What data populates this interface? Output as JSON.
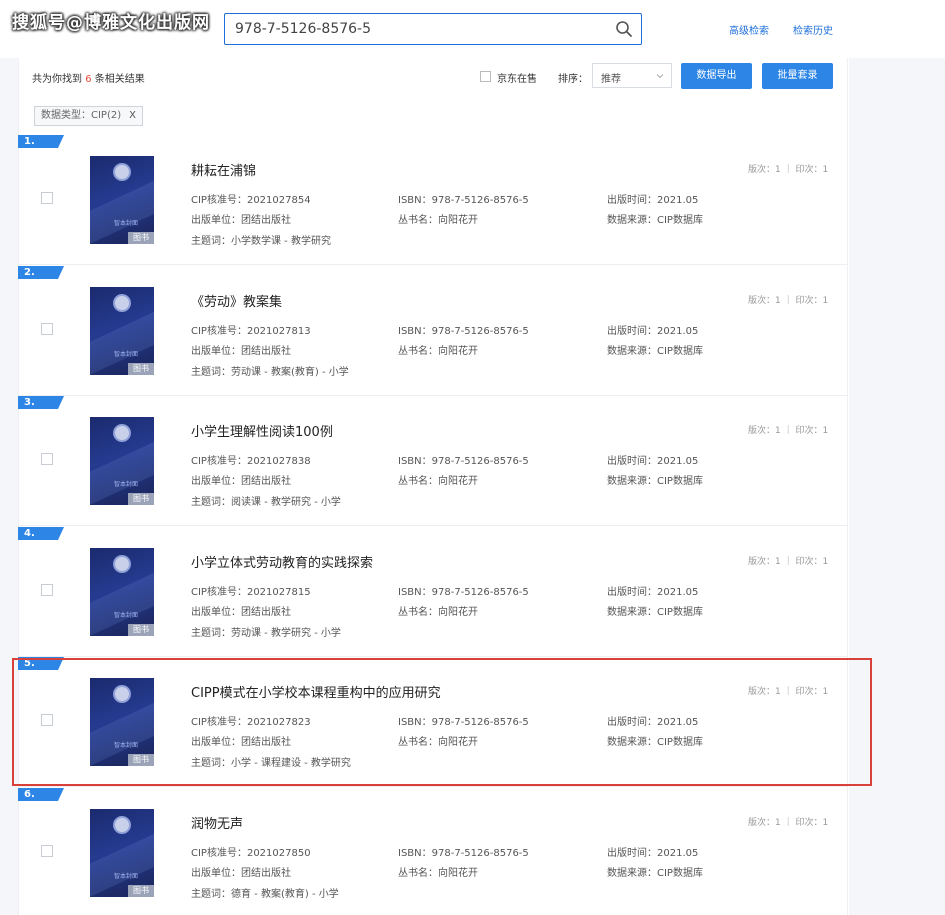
{
  "watermark": "搜狐号@博雅文化出版网",
  "search": {
    "value": "978-7-5126-8576-5",
    "advanced_label": "高级检索",
    "history_label": "检索历史"
  },
  "toolbar": {
    "result_prefix": "共为你找到",
    "result_count": "6",
    "result_suffix": "条相关结果",
    "jd_label": "京东在售",
    "sort_label": "排序：",
    "sort_value": "推荐",
    "export_label": "数据导出",
    "batch_label": "批量套录"
  },
  "filter": {
    "label": "数据类型：CIP(2)",
    "close": "X"
  },
  "cover_tag": "图书",
  "cover_text": "智本封面",
  "results": [
    {
      "num": "1.",
      "title": "耕耘在浦锦",
      "cip": "CIP核准号：2021027854",
      "isbn": "ISBN：978-7-5126-8576-5",
      "pubdate": "出版时间：2021.05",
      "publisher": "出版单位：团结出版社",
      "series": "丛书名：向阳花开",
      "source": "数据来源：CIP数据库",
      "subject": "主题词：小学数学课 - 教学研究",
      "edition": "版次：1 ｜ 印次：1"
    },
    {
      "num": "2.",
      "title": "《劳动》教案集",
      "cip": "CIP核准号：2021027813",
      "isbn": "ISBN：978-7-5126-8576-5",
      "pubdate": "出版时间：2021.05",
      "publisher": "出版单位：团结出版社",
      "series": "丛书名：向阳花开",
      "source": "数据来源：CIP数据库",
      "subject": "主题词：劳动课 - 教案(教育) - 小学",
      "edition": "版次：1 ｜ 印次：1"
    },
    {
      "num": "3.",
      "title": "小学生理解性阅读100例",
      "cip": "CIP核准号：2021027838",
      "isbn": "ISBN：978-7-5126-8576-5",
      "pubdate": "出版时间：2021.05",
      "publisher": "出版单位：团结出版社",
      "series": "丛书名：向阳花开",
      "source": "数据来源：CIP数据库",
      "subject": "主题词：阅读课 - 教学研究 - 小学",
      "edition": "版次：1 ｜ 印次：1"
    },
    {
      "num": "4.",
      "title": "小学立体式劳动教育的实践探索",
      "cip": "CIP核准号：2021027815",
      "isbn": "ISBN：978-7-5126-8576-5",
      "pubdate": "出版时间：2021.05",
      "publisher": "出版单位：团结出版社",
      "series": "丛书名：向阳花开",
      "source": "数据来源：CIP数据库",
      "subject": "主题词：劳动课 - 教学研究 - 小学",
      "edition": "版次：1 ｜ 印次：1"
    },
    {
      "num": "5.",
      "title": "CIPP模式在小学校本课程重构中的应用研究",
      "cip": "CIP核准号：2021027823",
      "isbn": "ISBN：978-7-5126-8576-5",
      "pubdate": "出版时间：2021.05",
      "publisher": "出版单位：团结出版社",
      "series": "丛书名：向阳花开",
      "source": "数据来源：CIP数据库",
      "subject": "主题词：小学 - 课程建设 - 教学研究",
      "edition": "版次：1 ｜ 印次：1"
    },
    {
      "num": "6.",
      "title": "润物无声",
      "cip": "CIP核准号：2021027850",
      "isbn": "ISBN：978-7-5126-8576-5",
      "pubdate": "出版时间：2021.05",
      "publisher": "出版单位：团结出版社",
      "series": "丛书名：向阳花开",
      "source": "数据来源：CIP数据库",
      "subject": "主题词：德育 - 教案(教育) - 小学",
      "edition": "版次：1 ｜ 印次：1"
    }
  ],
  "colors": {
    "accent": "#2d86e6",
    "highlight": "#d9403a",
    "count": "#e74c3c"
  }
}
